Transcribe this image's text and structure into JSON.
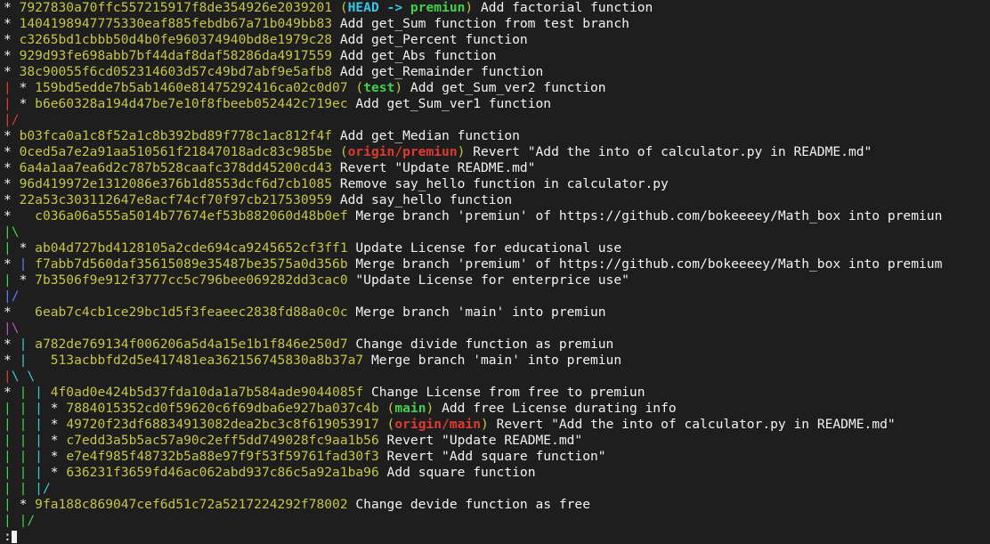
{
  "colors": {
    "background": "#1e1e1e",
    "text": "#f2f2f2",
    "hash": "#c6c640",
    "red": "#e03a2f",
    "green": "#3fd14a",
    "blue": "#5c7cff",
    "cyan": "#3ec8d8",
    "magenta": "#c452c4",
    "orange": "#e8762e"
  },
  "lines": [
    [
      [
        "white",
        "* "
      ],
      [
        "yellow",
        "7927830a70ffc557215917f8de354926e2039201 "
      ],
      [
        "yellow",
        "("
      ],
      [
        "head",
        "HEAD -> "
      ],
      [
        "branch-green",
        "premiun"
      ],
      [
        "yellow",
        ")"
      ],
      [
        "white",
        " Add factorial function"
      ]
    ],
    [
      [
        "white",
        "* "
      ],
      [
        "yellow",
        "1404198947775330eaf885febdb67a71b049bb83"
      ],
      [
        "white",
        " Add get_Sum function from test branch"
      ]
    ],
    [
      [
        "white",
        "* "
      ],
      [
        "yellow",
        "c3265bd1cbbb50d4b0fe960374940bd8e1979c28"
      ],
      [
        "white",
        " Add get_Percent function"
      ]
    ],
    [
      [
        "white",
        "* "
      ],
      [
        "yellow",
        "929d93fe698abb7bf44daf8daf58286da4917559"
      ],
      [
        "white",
        " Add get_Abs function"
      ]
    ],
    [
      [
        "white",
        "* "
      ],
      [
        "yellow",
        "38c90055f6cd052314603d57c49bd7abf9e5afb8"
      ],
      [
        "white",
        " Add get_Remainder function"
      ]
    ],
    [
      [
        "red",
        "| "
      ],
      [
        "white",
        "* "
      ],
      [
        "yellow",
        "159bd5edde7b5ab1460e81475292416ca02c0d07 "
      ],
      [
        "yellow",
        "("
      ],
      [
        "branch-green",
        "test"
      ],
      [
        "yellow",
        ")"
      ],
      [
        "white",
        " Add get_Sum_ver2 function"
      ]
    ],
    [
      [
        "red",
        "| "
      ],
      [
        "white",
        "* "
      ],
      [
        "yellow",
        "b6e60328a194d47be7e10f8fbeeb052442c719ec"
      ],
      [
        "white",
        " Add get_Sum_ver1 function"
      ]
    ],
    [
      [
        "red",
        "|/"
      ]
    ],
    [
      [
        "white",
        "* "
      ],
      [
        "yellow",
        "b03fca0a1c8f52a1c8b392bd89f778c1ac812f4f"
      ],
      [
        "white",
        " Add get_Median function"
      ]
    ],
    [
      [
        "white",
        "* "
      ],
      [
        "yellow",
        "0ced5a7e2a91aa510561f21847018adc83c985be "
      ],
      [
        "yellow",
        "("
      ],
      [
        "origin",
        "origin/premiun"
      ],
      [
        "yellow",
        ")"
      ],
      [
        "white",
        " Revert \"Add the into of calculator.py in README.md\""
      ]
    ],
    [
      [
        "white",
        "* "
      ],
      [
        "yellow",
        "6a4a1aa7ea6d2c787b528caafc378dd45200cd43"
      ],
      [
        "white",
        " Revert \"Update README.md\""
      ]
    ],
    [
      [
        "white",
        "* "
      ],
      [
        "yellow",
        "96d419972e1312086e376b1d8553dcf6d7cb1085"
      ],
      [
        "white",
        " Remove say_hello function in calculator.py"
      ]
    ],
    [
      [
        "white",
        "* "
      ],
      [
        "yellow",
        "22a53c303112647e8acf74cf70f97cb217530959"
      ],
      [
        "white",
        " Add say_hello function"
      ]
    ],
    [
      [
        "white",
        "*   "
      ],
      [
        "yellow",
        "c036a06a555a5014b77674ef53b882060d48b0ef"
      ],
      [
        "white",
        " Merge branch 'premiun' of https://github.com/bokeeeey/Math_box into premiun"
      ]
    ],
    [
      [
        "green",
        "|\\"
      ]
    ],
    [
      [
        "green",
        "| "
      ],
      [
        "white",
        "* "
      ],
      [
        "yellow",
        "ab04d727bd4128105a2cde694ca9245652cf3ff1"
      ],
      [
        "white",
        " Update License for educational use"
      ]
    ],
    [
      [
        "white",
        "* "
      ],
      [
        "blue",
        "| "
      ],
      [
        "yellow",
        "f7abb7d560daf35615089e35487be3575a0d356b"
      ],
      [
        "white",
        " Merge branch 'premium' of https://github.com/bokeeeey/Math_box into premium"
      ]
    ],
    [
      [
        "green",
        "| "
      ],
      [
        "white",
        "* "
      ],
      [
        "yellow",
        "7b3506f9e912f3777cc5c796bee069282dd3cac0"
      ],
      [
        "white",
        " \"Update License for enterprice use\""
      ]
    ],
    [
      [
        "blue",
        "|/"
      ]
    ],
    [
      [
        "white",
        "*   "
      ],
      [
        "yellow",
        "6eab7c4cb1ce29bc1d5f3feaeec2838fd88a0c0c"
      ],
      [
        "white",
        " Merge branch 'main' into premiun"
      ]
    ],
    [
      [
        "magenta",
        "|\\"
      ]
    ],
    [
      [
        "white",
        "* "
      ],
      [
        "cyan",
        "| "
      ],
      [
        "yellow",
        "a782de769134f006206a5d4a15e1b1f846e250d7"
      ],
      [
        "white",
        " Change divide function as premiun"
      ]
    ],
    [
      [
        "white",
        "* "
      ],
      [
        "cyan",
        "|   "
      ],
      [
        "yellow",
        "513acbbfd2d5e417481ea362156745830a8b37a7"
      ],
      [
        "white",
        " Merge branch 'main' into premiun"
      ]
    ],
    [
      [
        "red",
        "|"
      ],
      [
        "cyan",
        "\\ \\"
      ]
    ],
    [
      [
        "white",
        "* "
      ],
      [
        "green",
        "| "
      ],
      [
        "cyan",
        "| "
      ],
      [
        "yellow",
        "4f0ad0e424b5d37fda10da1a7b584ade9044085f"
      ],
      [
        "white",
        " Change License from free to premiun"
      ]
    ],
    [
      [
        "green",
        "| | "
      ],
      [
        "cyan",
        "| "
      ],
      [
        "white",
        "* "
      ],
      [
        "yellow",
        "7884015352cd0f59620c6f69dba6e927ba037c4b "
      ],
      [
        "yellow",
        "("
      ],
      [
        "branch-green",
        "main"
      ],
      [
        "yellow",
        ")"
      ],
      [
        "white",
        " Add free License durating info"
      ]
    ],
    [
      [
        "green",
        "| | "
      ],
      [
        "cyan",
        "| "
      ],
      [
        "white",
        "* "
      ],
      [
        "yellow",
        "49720f23df68834913082dea2bc3c8f619053917 "
      ],
      [
        "yellow",
        "("
      ],
      [
        "origin",
        "origin/main"
      ],
      [
        "yellow",
        ")"
      ],
      [
        "white",
        " Revert \"Add the into of calculator.py in README.md\""
      ]
    ],
    [
      [
        "green",
        "| | "
      ],
      [
        "cyan",
        "| "
      ],
      [
        "white",
        "* "
      ],
      [
        "yellow",
        "c7edd3a5b5ac57a90c2eff5dd749028fc9aa1b56"
      ],
      [
        "white",
        " Revert \"Update README.md\""
      ]
    ],
    [
      [
        "green",
        "| | "
      ],
      [
        "cyan",
        "| "
      ],
      [
        "white",
        "* "
      ],
      [
        "yellow",
        "e7e4f985f48732b5a88e97f9f53f59761fad30f3"
      ],
      [
        "white",
        " Revert \"Add square function\""
      ]
    ],
    [
      [
        "green",
        "| | "
      ],
      [
        "cyan",
        "| "
      ],
      [
        "white",
        "* "
      ],
      [
        "yellow",
        "636231f3659fd46ac062abd937c86c5a92a1ba96"
      ],
      [
        "white",
        " Add square function"
      ]
    ],
    [
      [
        "green",
        "| | "
      ],
      [
        "cyan",
        "|/"
      ]
    ],
    [
      [
        "green",
        "| "
      ],
      [
        "white",
        "* "
      ],
      [
        "yellow",
        "9fa188c869047cef6d51c72a5217224292f78002"
      ],
      [
        "white",
        " Change devide function as free"
      ]
    ],
    [
      [
        "green",
        "| "
      ],
      [
        "green",
        "|/"
      ]
    ],
    [
      [
        "white",
        ":"
      ]
    ]
  ]
}
